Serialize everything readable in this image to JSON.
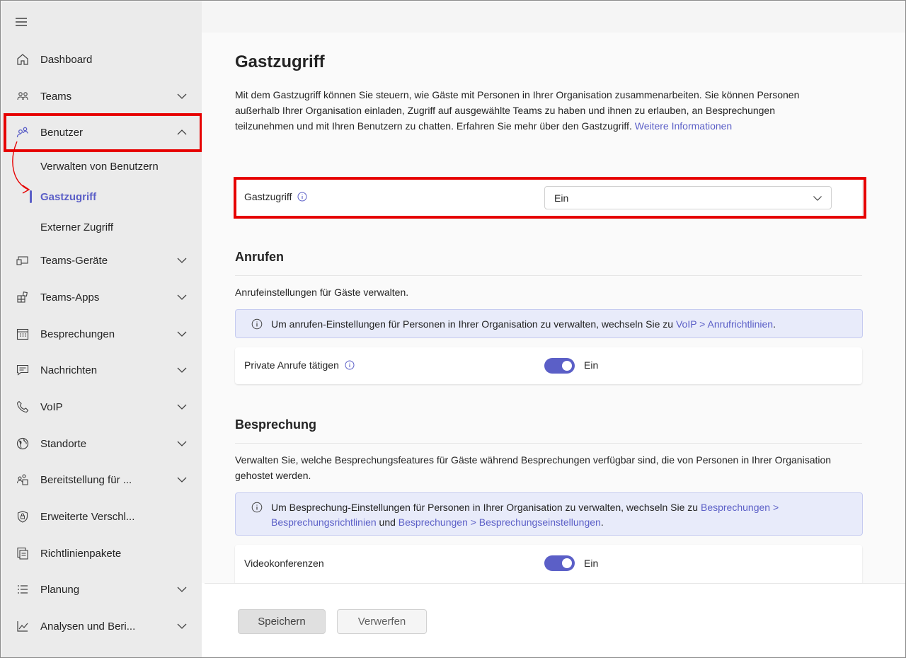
{
  "sidebar": {
    "items": [
      {
        "label": "Dashboard",
        "icon": "home-icon"
      },
      {
        "label": "Teams",
        "icon": "teams-icon"
      },
      {
        "label": "Benutzer",
        "icon": "users-icon"
      },
      {
        "label": "Teams-Geräte",
        "icon": "devices-icon"
      },
      {
        "label": "Teams-Apps",
        "icon": "apps-icon"
      },
      {
        "label": "Besprechungen",
        "icon": "calendar-icon"
      },
      {
        "label": "Nachrichten",
        "icon": "chat-icon"
      },
      {
        "label": "VoIP",
        "icon": "phone-icon"
      },
      {
        "label": "Standorte",
        "icon": "globe-icon"
      },
      {
        "label": "Bereitstellung für ...",
        "icon": "deployment-icon"
      },
      {
        "label": "Erweiterte Verschl...",
        "icon": "shield-icon"
      },
      {
        "label": "Richtlinienpakete",
        "icon": "policy-package-icon"
      },
      {
        "label": "Planung",
        "icon": "planning-icon"
      },
      {
        "label": "Analysen und Beri...",
        "icon": "analytics-icon"
      }
    ],
    "subitems": [
      {
        "label": "Verwalten von Benutzern"
      },
      {
        "label": "Gastzugriff"
      },
      {
        "label": "Externer Zugriff"
      }
    ]
  },
  "main": {
    "title": "Gastzugriff",
    "intro": "Mit dem Gastzugriff können Sie steuern, wie Gäste mit Personen in Ihrer Organisation zusammenarbeiten. Sie können Personen außerhalb Ihrer Organisation einladen, Zugriff auf ausgewählte Teams zu haben und ihnen zu erlauben, an Besprechungen teilzunehmen und mit Ihren Benutzern zu chatten. Erfahren Sie mehr über den Gastzugriff.",
    "intro_link": "Weitere Informationen",
    "guest_access": {
      "label": "Gastzugriff",
      "value": "Ein"
    },
    "calls": {
      "title": "Anrufen",
      "desc": "Anrufeinstellungen für Gäste verwalten.",
      "banner_text": "Um anrufen-Einstellungen für Personen in Ihrer Organisation zu verwalten, wechseln Sie zu",
      "banner_link": "VoIP > Anrufrichtlinien",
      "banner_end": ".",
      "private_calls_label": "Private Anrufe tätigen",
      "private_calls_value": "Ein"
    },
    "meeting": {
      "title": "Besprechung",
      "desc": "Verwalten Sie, welche Besprechungsfeatures für Gäste während Besprechungen verfügbar sind, die von Personen in Ihrer Organisation gehostet werden.",
      "banner_text": "Um Besprechung-Einstellungen für Personen in Ihrer Organisation zu verwalten, wechseln Sie zu",
      "banner_link1": "Besprechungen > Besprechungsrichtlinien",
      "banner_and": "und",
      "banner_link2": "Besprechungen > Besprechungseinstellungen",
      "banner_end": ".",
      "video_label": "Videokonferenzen",
      "video_value": "Ein"
    }
  },
  "footer": {
    "save": "Speichern",
    "discard": "Verwerfen"
  },
  "colors": {
    "accent": "#5b5fc7",
    "highlight": "#e60000"
  }
}
